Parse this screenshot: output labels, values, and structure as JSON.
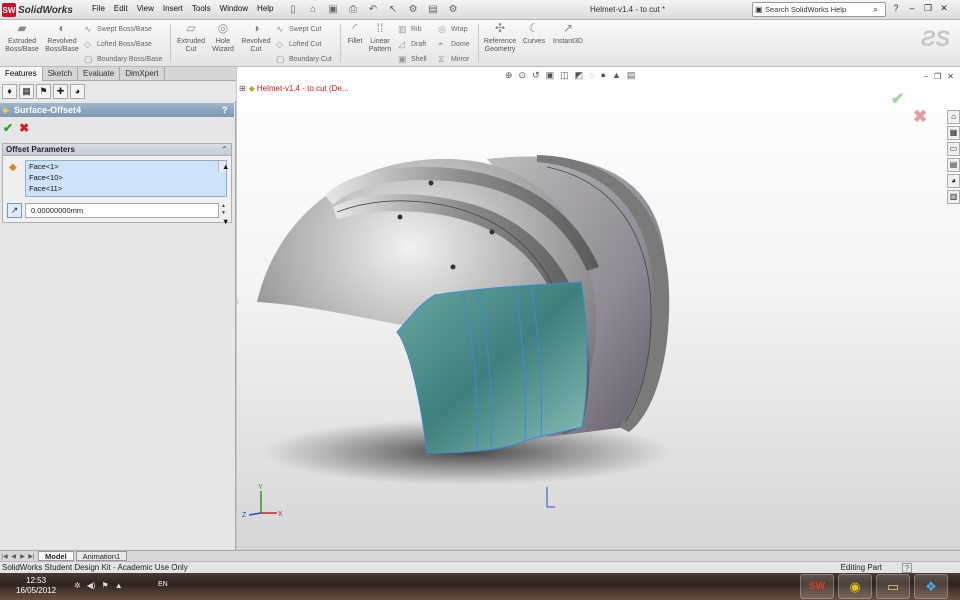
{
  "app": {
    "logo_mark": "SW",
    "logo_text": "SolidWorks",
    "menus": [
      "File",
      "Edit",
      "View",
      "Insert",
      "Tools",
      "Window",
      "Help"
    ],
    "document_title": "Helmet-v1.4 - to cut *",
    "search_placeholder": "Search SolidWorks Help"
  },
  "commands": {
    "extruded_boss": "Extruded Boss/Base",
    "revolved_boss": "Revolved Boss/Base",
    "swept_boss": "Swept Boss/Base",
    "lofted_boss": "Lofted Boss/Base",
    "boundary_boss": "Boundary Boss/Base",
    "extruded_cut": "Extruded Cut",
    "hole_wizard": "Hole Wizard",
    "revolved_cut": "Revolved Cut",
    "swept_cut": "Swept Cut",
    "lofted_cut": "Lofted Cut",
    "boundary_cut": "Boundary Cut",
    "fillet": "Fillet",
    "linear_pattern": "Linear Pattern",
    "rib": "Rib",
    "draft": "Draft",
    "shell": "Shell",
    "wrap": "Wrap",
    "dome": "Dome",
    "mirror": "Mirror",
    "reference_geometry": "Reference Geometry",
    "curves": "Curves",
    "instant3d": "Instant3D"
  },
  "left_panel": {
    "tabs": [
      "Features",
      "Sketch",
      "Evaluate",
      "DimXpert"
    ],
    "property_title": "Surface-Offset4",
    "help": "?",
    "group_title": "Offset Parameters",
    "faces": [
      "Face<1>",
      "Face<10>",
      "Face<11>"
    ],
    "distance": "0.00000000mm"
  },
  "viewport": {
    "tree_label": "Helmet-v1.4 - to cut  (De..."
  },
  "bottom": {
    "tabs": [
      "Model",
      "Animation1"
    ],
    "status_left": "SolidWorks Student Design Kit - Academic Use Only",
    "status_mode": "Editing Part",
    "status_help": "?"
  },
  "taskbar": {
    "time": "12:53",
    "date": "16/05/2012",
    "lang": "EN"
  },
  "colors": {
    "accent": "#7e98b4",
    "selection": "#cfe3f8",
    "ok": "#2aa02a",
    "cancel": "#d42020",
    "highlight_face": "#5a9a98"
  }
}
